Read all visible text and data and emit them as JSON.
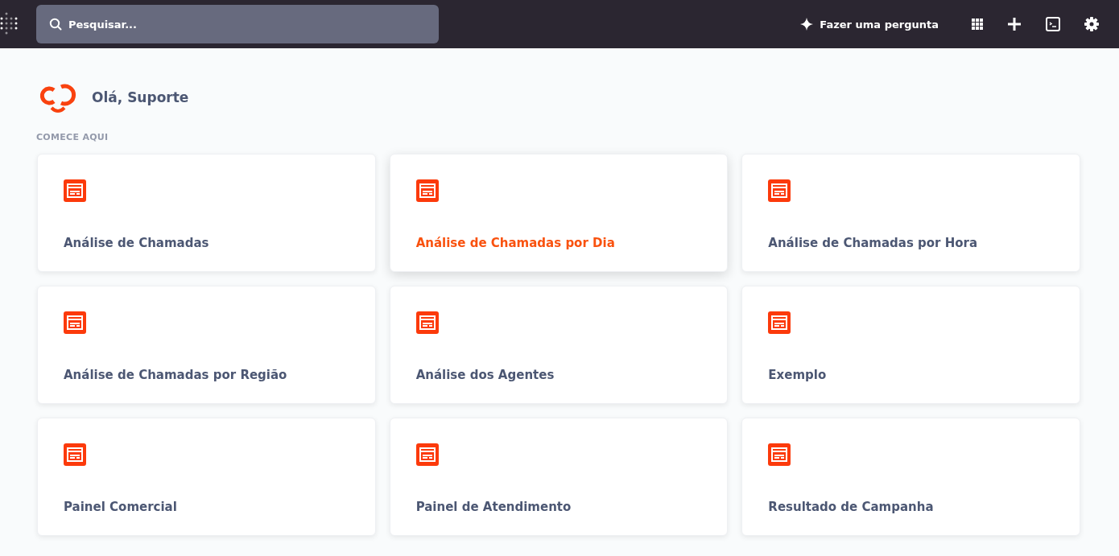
{
  "topbar": {
    "search": {
      "placeholder": "Pesquisar..."
    },
    "ask_button": "Fazer uma pergunta"
  },
  "greeting": "Olá, Suporte",
  "section_title": "COMECE AQUI",
  "cards": [
    {
      "title": "Análise de Chamadas",
      "hovered": false
    },
    {
      "title": "Análise de Chamadas por Dia",
      "hovered": true
    },
    {
      "title": "Análise de Chamadas por Hora",
      "hovered": false
    },
    {
      "title": "Análise de Chamadas por Região",
      "hovered": false
    },
    {
      "title": "Análise dos Agentes",
      "hovered": false
    },
    {
      "title": "Exemplo",
      "hovered": false
    },
    {
      "title": "Painel Comercial",
      "hovered": false
    },
    {
      "title": "Painel de Atendimento",
      "hovered": false
    },
    {
      "title": "Resultado de Campanha",
      "hovered": false
    }
  ]
}
